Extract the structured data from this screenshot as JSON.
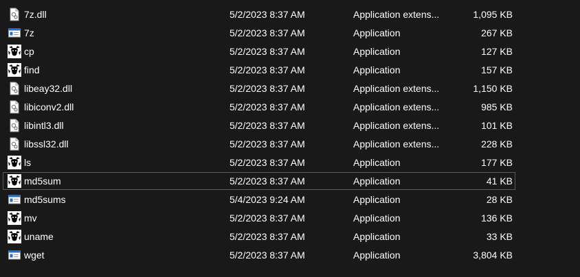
{
  "files": [
    {
      "name": "7z.dll",
      "date": "5/2/2023 8:37 AM",
      "type": "Application extens...",
      "size": "1,095 KB",
      "icon": "dll-file-icon"
    },
    {
      "name": "7z",
      "date": "5/2/2023 8:37 AM",
      "type": "Application",
      "size": "267 KB",
      "icon": "window-app-icon"
    },
    {
      "name": "cp",
      "date": "5/2/2023 8:37 AM",
      "type": "Application",
      "size": "127 KB",
      "icon": "gnu-app-icon"
    },
    {
      "name": "find",
      "date": "5/2/2023 8:37 AM",
      "type": "Application",
      "size": "157 KB",
      "icon": "gnu-app-icon"
    },
    {
      "name": "libeay32.dll",
      "date": "5/2/2023 8:37 AM",
      "type": "Application extens...",
      "size": "1,150 KB",
      "icon": "dll-file-icon"
    },
    {
      "name": "libiconv2.dll",
      "date": "5/2/2023 8:37 AM",
      "type": "Application extens...",
      "size": "985 KB",
      "icon": "dll-file-icon"
    },
    {
      "name": "libintl3.dll",
      "date": "5/2/2023 8:37 AM",
      "type": "Application extens...",
      "size": "101 KB",
      "icon": "dll-file-icon"
    },
    {
      "name": "libssl32.dll",
      "date": "5/2/2023 8:37 AM",
      "type": "Application extens...",
      "size": "228 KB",
      "icon": "dll-file-icon"
    },
    {
      "name": "ls",
      "date": "5/2/2023 8:37 AM",
      "type": "Application",
      "size": "177 KB",
      "icon": "gnu-app-icon"
    },
    {
      "name": "md5sum",
      "date": "5/2/2023 8:37 AM",
      "type": "Application",
      "size": "41 KB",
      "icon": "gnu-app-icon",
      "selected": true
    },
    {
      "name": "md5sums",
      "date": "5/4/2023 9:24 AM",
      "type": "Application",
      "size": "28 KB",
      "icon": "window-app-icon"
    },
    {
      "name": "mv",
      "date": "5/2/2023 8:37 AM",
      "type": "Application",
      "size": "136 KB",
      "icon": "gnu-app-icon"
    },
    {
      "name": "uname",
      "date": "5/2/2023 8:37 AM",
      "type": "Application",
      "size": "33 KB",
      "icon": "gnu-app-icon"
    },
    {
      "name": "wget",
      "date": "5/2/2023 8:37 AM",
      "type": "Application",
      "size": "3,804 KB",
      "icon": "window-app-icon"
    }
  ],
  "colors": {
    "background": "#191919",
    "text": "#ffffff",
    "selection_border": "#5a5a5a",
    "app_icon_blue": "#1f6fd1"
  }
}
